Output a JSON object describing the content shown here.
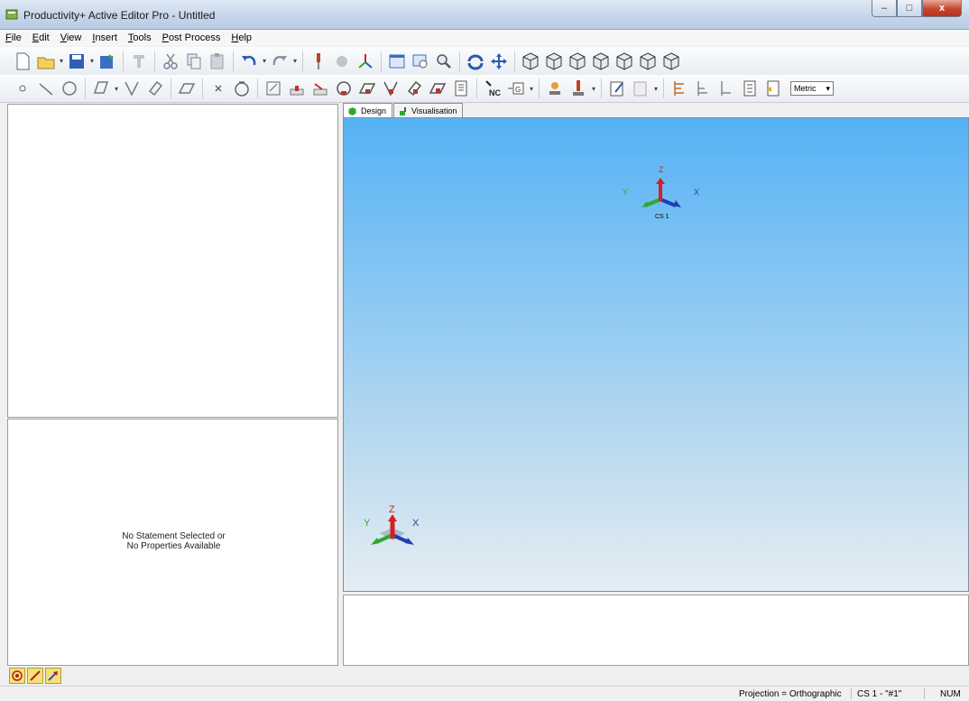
{
  "window": {
    "title": "Productivity+ Active Editor Pro - Untitled"
  },
  "menu": [
    "File",
    "Edit",
    "View",
    "Insert",
    "Tools",
    "Post Process",
    "Help"
  ],
  "toolbar2": {
    "units_select": "Metric"
  },
  "tabs": [
    {
      "label": "Design",
      "active": true
    },
    {
      "label": "Visualisation",
      "active": false
    }
  ],
  "properties_panel": {
    "line1": "No Statement Selected or",
    "line2": "No Properties Available"
  },
  "viewport": {
    "cs": {
      "x": "X",
      "y": "Y",
      "z": "Z",
      "name": "CS 1"
    },
    "corner_triad": {
      "x": "X",
      "y": "Y",
      "z": "Z"
    }
  },
  "status": {
    "projection": "Projection = Orthographic",
    "cs": "CS 1 - \"#1\"",
    "num": "NUM"
  },
  "colors": {
    "viewport_top": "#56b2f4",
    "viewport_bottom": "#e5edf4",
    "axis_x": "#1f3fb3",
    "axis_y": "#2ea82e",
    "axis_z": "#d42020"
  }
}
